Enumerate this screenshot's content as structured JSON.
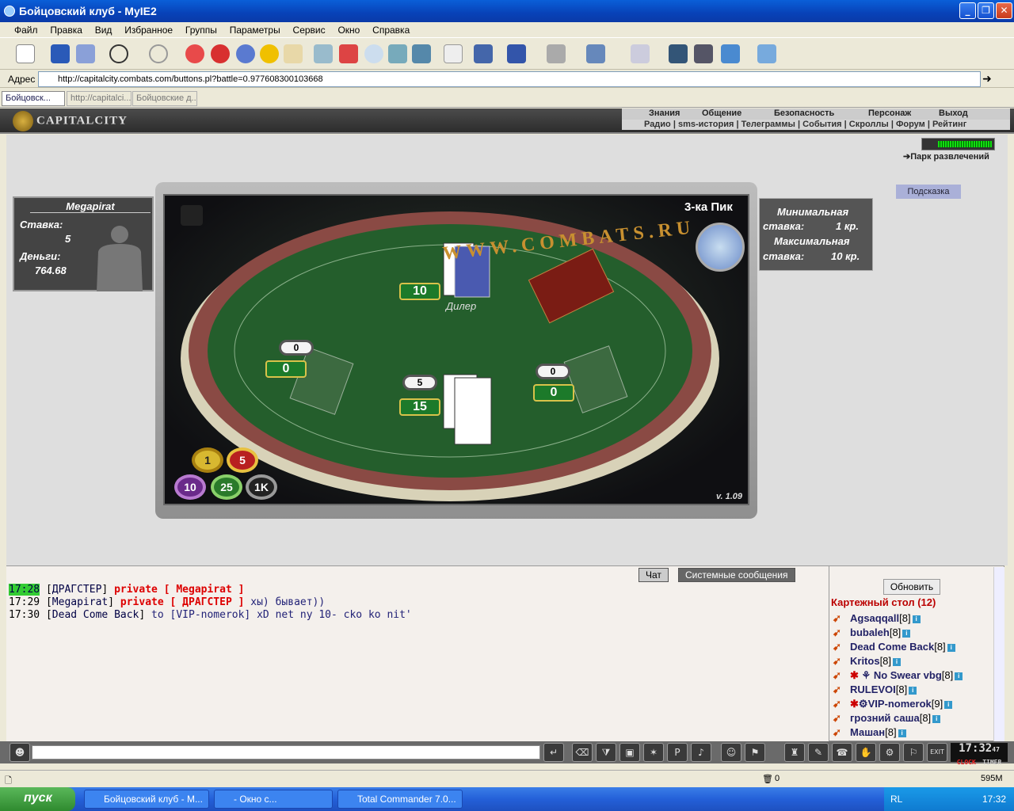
{
  "window": {
    "title": "Бойцовский клуб - MyIE2"
  },
  "menu": [
    "Файл",
    "Правка",
    "Вид",
    "Избранное",
    "Группы",
    "Параметры",
    "Сервис",
    "Окно",
    "Справка"
  ],
  "address": {
    "label": "Адрес",
    "url": "http://capitalcity.combats.com/buttons.pl?battle=0.977608300103668"
  },
  "tabs": [
    "Бойцовск...",
    "http://capitalci...",
    "Бойцовские д..."
  ],
  "site": {
    "logo": "CAPITALCITY",
    "nav_top": [
      "Знания",
      "Общение",
      "Безопасность",
      "Персонаж",
      "Выход"
    ],
    "nav_bottom": [
      "Радио",
      "sms-история",
      "Телеграммы",
      "События",
      "Скроллы",
      "Форум",
      "Рейтинг"
    ],
    "park_link": "Парк развлечений",
    "hint_button": "Подсказка"
  },
  "player": {
    "name": "Megapirat",
    "stake_label": "Ставка:",
    "stake": "5",
    "money_label": "Деньги:",
    "money": "764.68"
  },
  "limits": {
    "min_label": "Минимальная",
    "min_prefix": "ставка:",
    "min_value": "1 кр.",
    "max_label": "Максимальная",
    "max_prefix": "ставка:",
    "max_value": "10 кр."
  },
  "table": {
    "felt_text": "WWW.COMBATS.RU",
    "last_card": "3-ка Пик",
    "dealer_label": "Дилер",
    "dealer_total": "10",
    "left_bet": "0",
    "left_total": "0",
    "center_bet": "5",
    "center_total": "15",
    "right_bet": "0",
    "right_total": "0",
    "chips": [
      "1",
      "5",
      "10",
      "25",
      "1K"
    ],
    "version": "v. 1.09"
  },
  "chat": {
    "tabs": [
      "Чат",
      "Системные сообщения"
    ],
    "lines": [
      {
        "time": "17:28",
        "nick": "ДРАГСТЕР",
        "private": "private [ Megapirat ]",
        "msg": ""
      },
      {
        "time": "17:29",
        "nick": "Megapirat",
        "private": "private [ ДРАГСТЕР ]",
        "msg": "хы) бывает))"
      },
      {
        "time": "17:30",
        "nick": "Dead Come Back",
        "private": "",
        "msg": "to [VIP-nomerok] xD net ny 10- cko ko nit'"
      }
    ]
  },
  "users": {
    "refresh": "Обновить",
    "room": "Картежный стол (12)",
    "list": [
      {
        "name": "Agsaqqall",
        "level": "[8]"
      },
      {
        "name": "bubaleh",
        "level": "[8]"
      },
      {
        "name": "Dead Come Back",
        "level": "[8]"
      },
      {
        "name": "Kritos",
        "level": "[8]"
      },
      {
        "name": "No Swear vbg",
        "level": "[8]"
      },
      {
        "name": "RULEVOI",
        "level": "[8]"
      },
      {
        "name": "VIP-nomerok",
        "level": "[9]"
      },
      {
        "name": "грозний саша",
        "level": "[8]"
      },
      {
        "name": "Машан",
        "level": "[8]"
      }
    ]
  },
  "clock": {
    "time": "17:32",
    "sec": "47",
    "clock_lbl": "CLOCK",
    "timer_lbl": "TIMER",
    "exit_lbl": "EXIT"
  },
  "statusbar": {
    "count": "0",
    "mem": "595M"
  },
  "taskbar": {
    "start": "пуск",
    "tasks": [
      "Бойцовский клуб - M...",
      "- Окно с...",
      "Total Commander 7.0..."
    ],
    "lang": "RL",
    "time": "17:32"
  }
}
